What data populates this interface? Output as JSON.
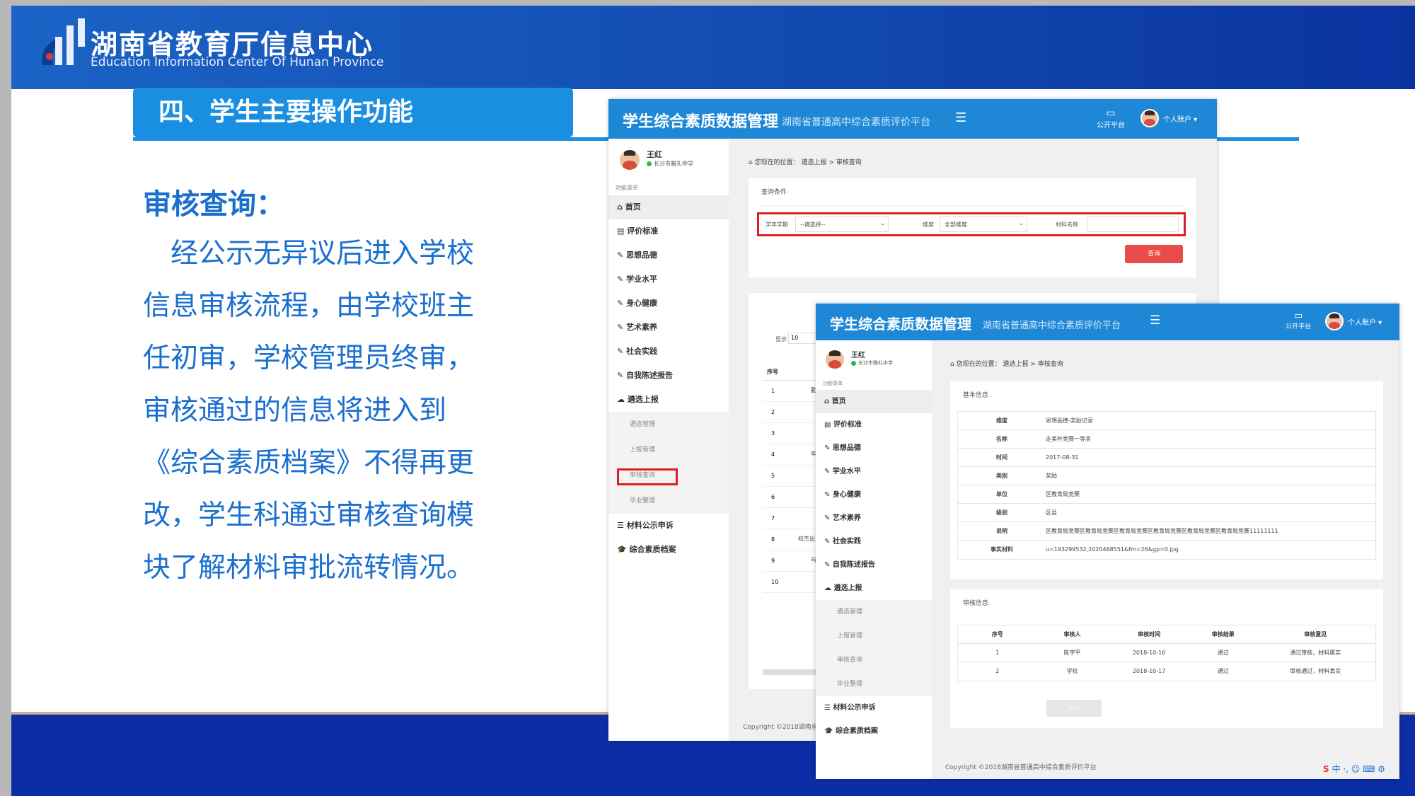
{
  "slide": {
    "org_name_cn": "湖南省教育厅信息中心",
    "org_name_en": "Education Information Center Of Hunan Province",
    "section_title": "四、学生主要操作功能",
    "subheading": "审核查询：",
    "body_lines": [
      "　经公示无异议后进入学校",
      "信息审核流程，由学校班主",
      "任初审，学校管理员终审，",
      "审核通过的信息将进入到",
      "《综合素质档案》不得再更",
      "改，学生科通过审核查询模",
      "块了解材料审批流转情况。"
    ]
  },
  "app": {
    "title": "学生综合素质数据管理",
    "subtitle": "湖南省普通高中综合素质评价平台",
    "public_platform": "公开平台",
    "user_menu": "个人账户",
    "user_name": "王红",
    "user_school": "长沙市雅礼中学",
    "menu_label": "功能菜单",
    "sidebar": [
      {
        "label": "首页",
        "icon": "dashboard-icon"
      },
      {
        "label": "评价标准",
        "icon": "book-icon"
      },
      {
        "label": "思想品德",
        "icon": "edit-icon"
      },
      {
        "label": "学业水平",
        "icon": "edit-icon"
      },
      {
        "label": "身心健康",
        "icon": "edit-icon"
      },
      {
        "label": "艺术素养",
        "icon": "edit-icon"
      },
      {
        "label": "社会实践",
        "icon": "edit-icon"
      },
      {
        "label": "自我陈述报告",
        "icon": "edit-icon"
      },
      {
        "label": "遴选上报",
        "icon": "cloud-upload-icon"
      }
    ],
    "sub_items": [
      "遴选管理",
      "上报管理",
      "审核查询",
      "毕业整理"
    ],
    "sidebar_bottom": [
      {
        "label": "材料公示申诉",
        "icon": "list-icon"
      },
      {
        "label": "综合素质档案",
        "icon": "graduation-cap-icon"
      }
    ],
    "breadcrumb_prefix": "您现在的位置：",
    "breadcrumb_parent": "遴选上报",
    "breadcrumb_current": "审核查询",
    "copyright": "Copyright ©2018湖南省普通高中综合素质评价平台",
    "copyright_partial": "Copyright ©2018湖南省"
  },
  "screen1": {
    "query_title": "查询条件",
    "term_label": "学年学期",
    "term_value": "--请选择--",
    "dimension_label": "维度",
    "dimension_value": "全部维度",
    "material_label": "材料名称",
    "material_value": "",
    "query_button": "查询",
    "show_label": "显示",
    "show_value": "10",
    "col_seq": "序号",
    "rows": [
      "1",
      "2",
      "3",
      "4",
      "5",
      "6",
      "7",
      "8",
      "9",
      "10"
    ],
    "row_fragments": {
      "1": "勤",
      "4": "华",
      "8": "校杰出",
      "9": "与"
    }
  },
  "screen2": {
    "basic_title": "基本信息",
    "basic_rows": [
      {
        "key": "维度",
        "value": "思想品德-奖励记录"
      },
      {
        "key": "名称",
        "value": "走美杯竞赛一等奖"
      },
      {
        "key": "时间",
        "value": "2017-08-31"
      },
      {
        "key": "类别",
        "value": "奖励"
      },
      {
        "key": "单位",
        "value": "区教育局竞赛"
      },
      {
        "key": "级别",
        "value": "区县"
      },
      {
        "key": "说明",
        "value": "区教育局竞赛区教育局竞赛区教育局竞赛区教育局竞赛区教育局竞赛区教育局竞赛11111111"
      },
      {
        "key": "事实材料",
        "value": "u=193299532,2020468551&fm=26&gp=0.jpg"
      }
    ],
    "audit_title": "审核信息",
    "audit_headers": [
      "序号",
      "审核人",
      "审核时间",
      "审核结果",
      "审核意见"
    ],
    "audit_rows": [
      [
        "1",
        "陈宇平",
        "2018-10-16",
        "通过",
        "通过审核，材料属实"
      ],
      [
        "2",
        "学校",
        "2018-10-17",
        "通过",
        "审核通过，材料真实"
      ]
    ],
    "back_button": "返回",
    "ime_status": "中 ·, ☺ ⌨ ⚙"
  },
  "colors": {
    "header_blue": "#1e88d6",
    "text_blue": "#1a6fcf",
    "highlight_red": "#e01b24",
    "button_red": "#e94a4a"
  }
}
